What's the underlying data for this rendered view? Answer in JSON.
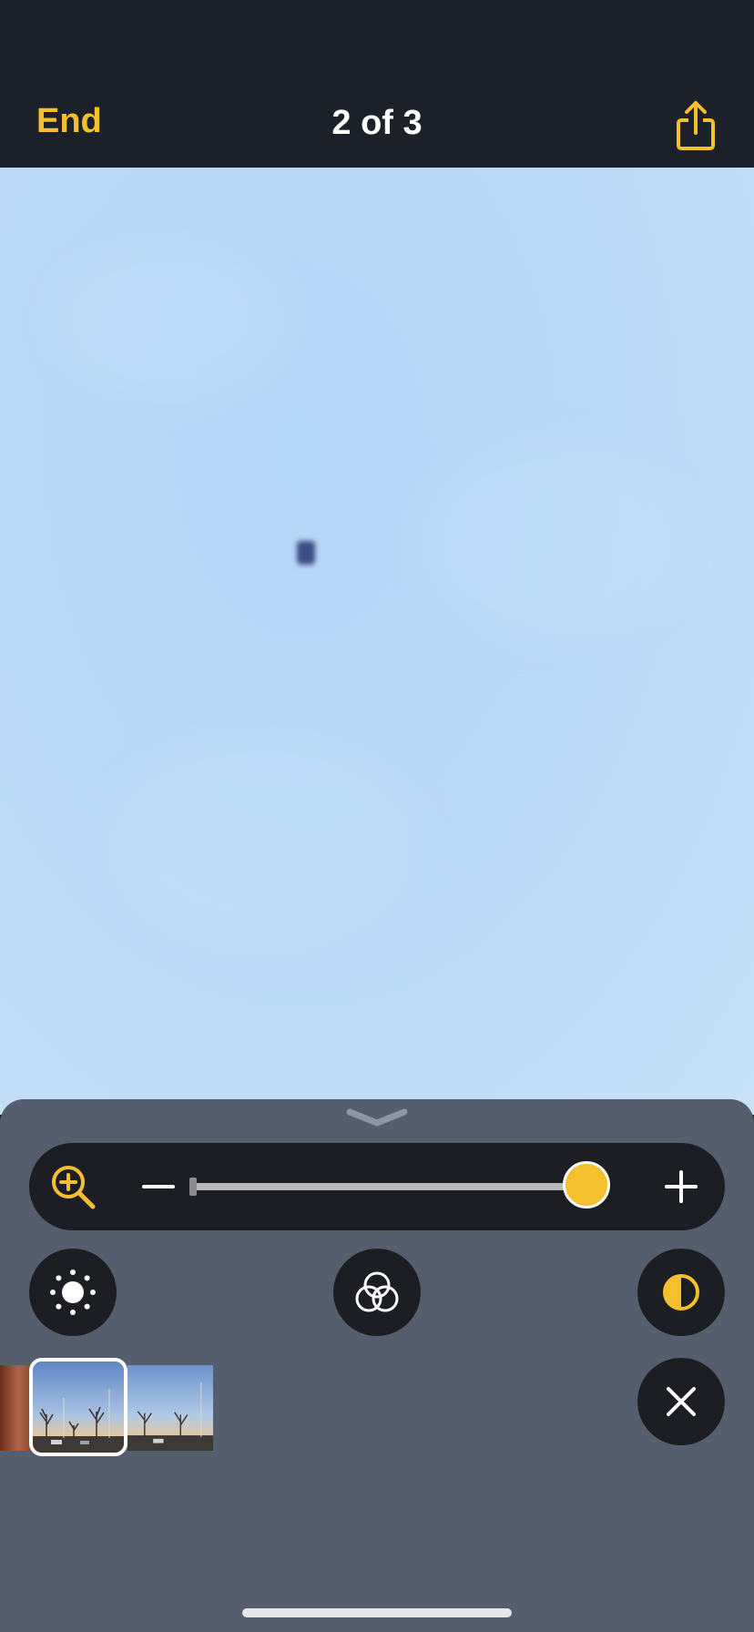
{
  "header": {
    "end_label": "End",
    "counter": "2 of 3",
    "share_icon": "share-icon"
  },
  "zoom": {
    "icon": "zoom-in-icon",
    "minus_icon": "minus-icon",
    "plus_icon": "plus-icon",
    "level_fraction": 1.0
  },
  "controls": {
    "brightness_icon": "sun-brightness-icon",
    "filters_icon": "color-filters-icon",
    "contrast_icon": "contrast-icon",
    "close_icon": "close-icon"
  },
  "thumbnails": {
    "count": 3,
    "current_index": 2
  },
  "colors": {
    "accent": "#f5c02e",
    "navbar": "#1c2029",
    "panel": "#555e6e",
    "control": "#1c1e24"
  }
}
